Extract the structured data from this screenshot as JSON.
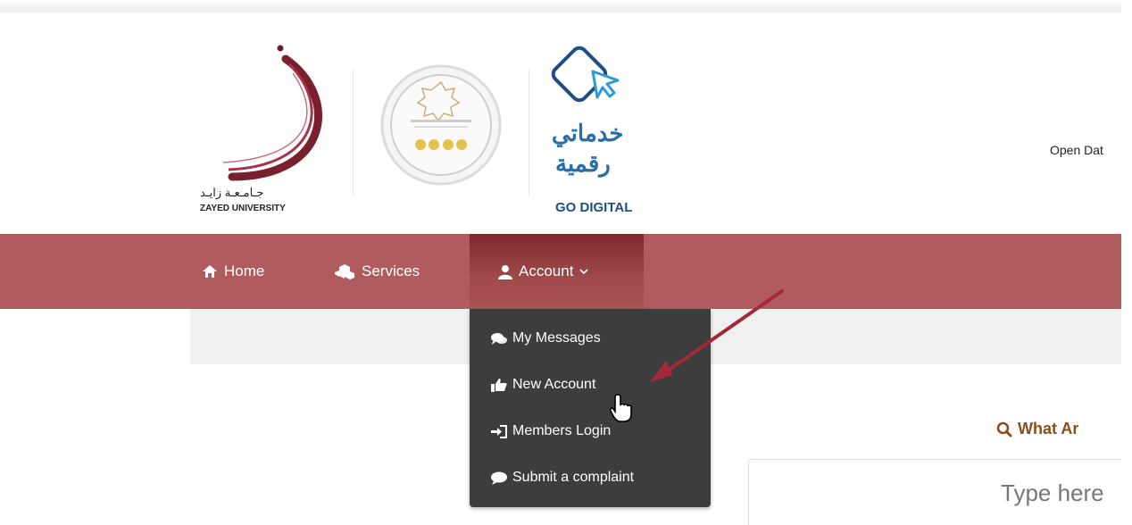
{
  "header": {
    "zayed_logo": {
      "arabic": "جـامـعـة زايـد",
      "english": "ZAYED UNIVERSITY"
    },
    "rating_badge": {
      "icon": "star-rating-badge-icon"
    },
    "go_digital_logo": {
      "arabic_line1": "خدماتي",
      "arabic_line2": "رقمية",
      "english": "GO DIGITAL"
    },
    "open_data_link": "Open Dat"
  },
  "navbar": {
    "items": [
      {
        "label": "Home",
        "icon": "home-icon"
      },
      {
        "label": "Services",
        "icon": "cubes-icon"
      },
      {
        "label": "Account",
        "icon": "user-icon",
        "caret": "chevron-down-icon"
      }
    ]
  },
  "account_dropdown": {
    "items": [
      {
        "label": "My Messages",
        "icon": "comments-icon"
      },
      {
        "label": "New Account",
        "icon": "thumbs-up-icon"
      },
      {
        "label": "Members Login",
        "icon": "sign-in-icon"
      },
      {
        "label": "Submit a complaint",
        "icon": "comment-icon"
      }
    ]
  },
  "search": {
    "heading": "What Ar",
    "placeholder": "Type here"
  },
  "colors": {
    "navbar": "#b05c5e",
    "dropdown": "#3d3d3d",
    "heading": "#8a4e1a",
    "logo_blue": "#2a6ea8"
  }
}
